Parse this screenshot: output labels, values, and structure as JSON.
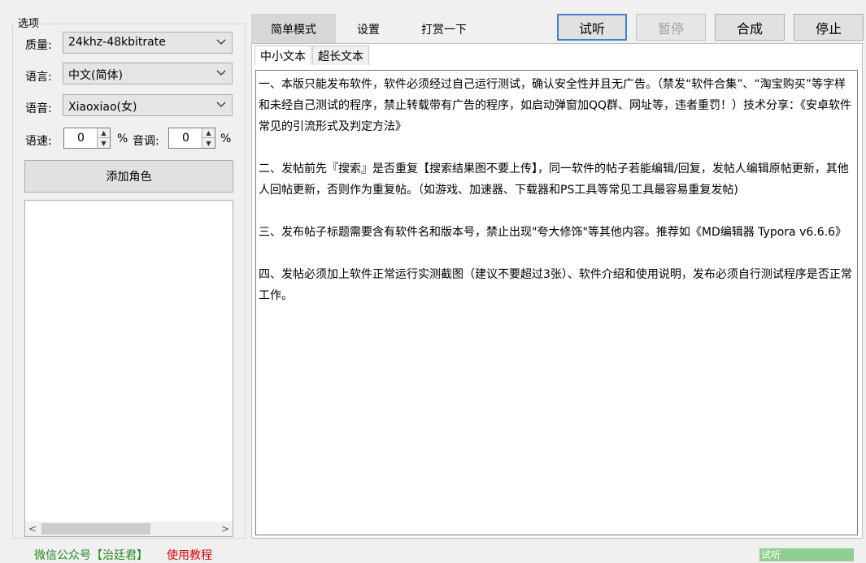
{
  "options_group": {
    "title": "选项"
  },
  "quality": {
    "label": "质量:",
    "value": "24khz-48kbitrate"
  },
  "language": {
    "label": "语言:",
    "value": "中文(简体)"
  },
  "voice": {
    "label": "语音:",
    "value": "Xiaoxiao(女)"
  },
  "rate": {
    "label": "语速:",
    "value": "0",
    "unit": "%"
  },
  "pitch": {
    "label": "音调:",
    "value": "0",
    "unit": "%"
  },
  "add_role_label": "添加角色",
  "tabs": [
    {
      "label": "简单模式"
    },
    {
      "label": "设置"
    },
    {
      "label": "打赏一下"
    }
  ],
  "buttons": {
    "preview": "试听",
    "pause": "暂停",
    "synthesize": "合成",
    "stop": "停止"
  },
  "inner_tabs": [
    {
      "label": "中小文本"
    },
    {
      "label": "超长文本"
    }
  ],
  "text_paragraphs": [
    "一、本版只能发布软件，软件必须经过自己运行测试，确认安全性并且无广告。（禁发“软件合集”、“淘宝购买”等字样和未经自己测试的程序，禁止转载带有广告的程序，如启动弹窗加QQ群、网址等，违者重罚！）技术分享：《安卓软件常见的引流形式及判定方法》",
    "二、发帖前先『搜索』是否重复【搜索结果图不要上传】，同一软件的帖子若能编辑/回复，发帖人编辑原帖更新，其他人回帖更新，否则作为重复帖。（如游戏、加速器、下载器和PS工具等常见工具最容易重复发帖)",
    "三、发布帖子标题需要含有软件名和版本号，禁止出现\"夸大修饰\"等其他内容。推荐如《MD编辑器 Typora v6.6.6》",
    "四、发帖必须加上软件正常运行实测截图（建议不要超过3张）、软件介绍和使用说明，发布必须自行测试程序是否正常工作。"
  ],
  "footer": {
    "wechat": "微信公众号【治廷君】",
    "tutorial": "使用教程",
    "status": "试听"
  },
  "colors": {
    "wechat_link": "#228b22",
    "tutorial_link": "#e00000",
    "focus_border": "#3f7fd6",
    "status_fill": "#8fcf8f"
  }
}
